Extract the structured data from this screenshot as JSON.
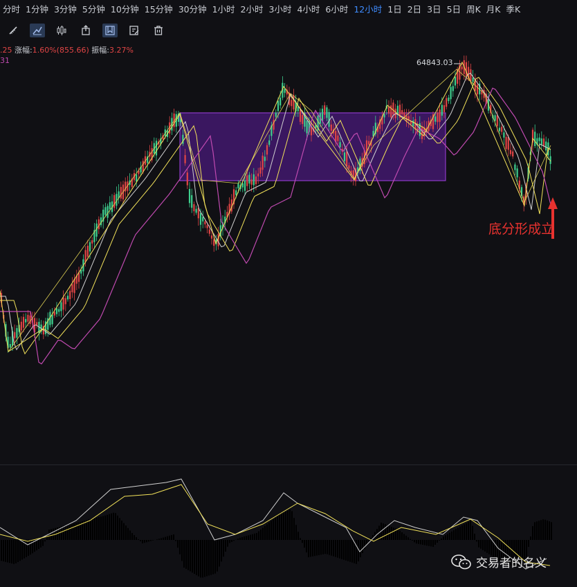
{
  "timeframes": [
    {
      "label": "分时",
      "active": false
    },
    {
      "label": "1分钟",
      "active": false
    },
    {
      "label": "3分钟",
      "active": false
    },
    {
      "label": "5分钟",
      "active": false
    },
    {
      "label": "10分钟",
      "active": false
    },
    {
      "label": "15分钟",
      "active": false
    },
    {
      "label": "30分钟",
      "active": false
    },
    {
      "label": "1小时",
      "active": false
    },
    {
      "label": "2小时",
      "active": false
    },
    {
      "label": "3小时",
      "active": false
    },
    {
      "label": "4小时",
      "active": false
    },
    {
      "label": "6小时",
      "active": false
    },
    {
      "label": "12小时",
      "active": true
    },
    {
      "label": "1日",
      "active": false
    },
    {
      "label": "2日",
      "active": false
    },
    {
      "label": "3日",
      "active": false
    },
    {
      "label": "5日",
      "active": false
    },
    {
      "label": "周K",
      "active": false
    },
    {
      "label": "月K",
      "active": false
    },
    {
      "label": "季K",
      "active": false
    }
  ],
  "tools": [
    {
      "name": "ruler-icon",
      "active": false
    },
    {
      "name": "draw-line-icon",
      "active": true
    },
    {
      "name": "candle-style-icon",
      "active": false
    },
    {
      "name": "share-icon",
      "active": false
    },
    {
      "name": "bookmark-icon",
      "active": true
    },
    {
      "name": "edit-note-icon",
      "active": false
    },
    {
      "name": "trash-icon",
      "active": false
    }
  ],
  "stats": {
    "prefix": ".25",
    "change_label": "涨幅:",
    "change_value": "1.60%(855.66)",
    "amp_label": "振幅:",
    "amp_value": "3.27%",
    "line2": "31"
  },
  "chart": {
    "high_label": "64843.03",
    "annotation": "底分形成立",
    "colors": {
      "up": "#e04545",
      "down": "#3ecf8e",
      "yellow": "#f2e25a",
      "white": "#d0d0d0",
      "magenta": "#c04ab0",
      "box_fill": "#3a1760",
      "box_stroke": "#a040e0",
      "arrow": "#e8322f"
    }
  },
  "watermark": {
    "text": "交易者的名义",
    "icon": "wechat-icon"
  }
}
